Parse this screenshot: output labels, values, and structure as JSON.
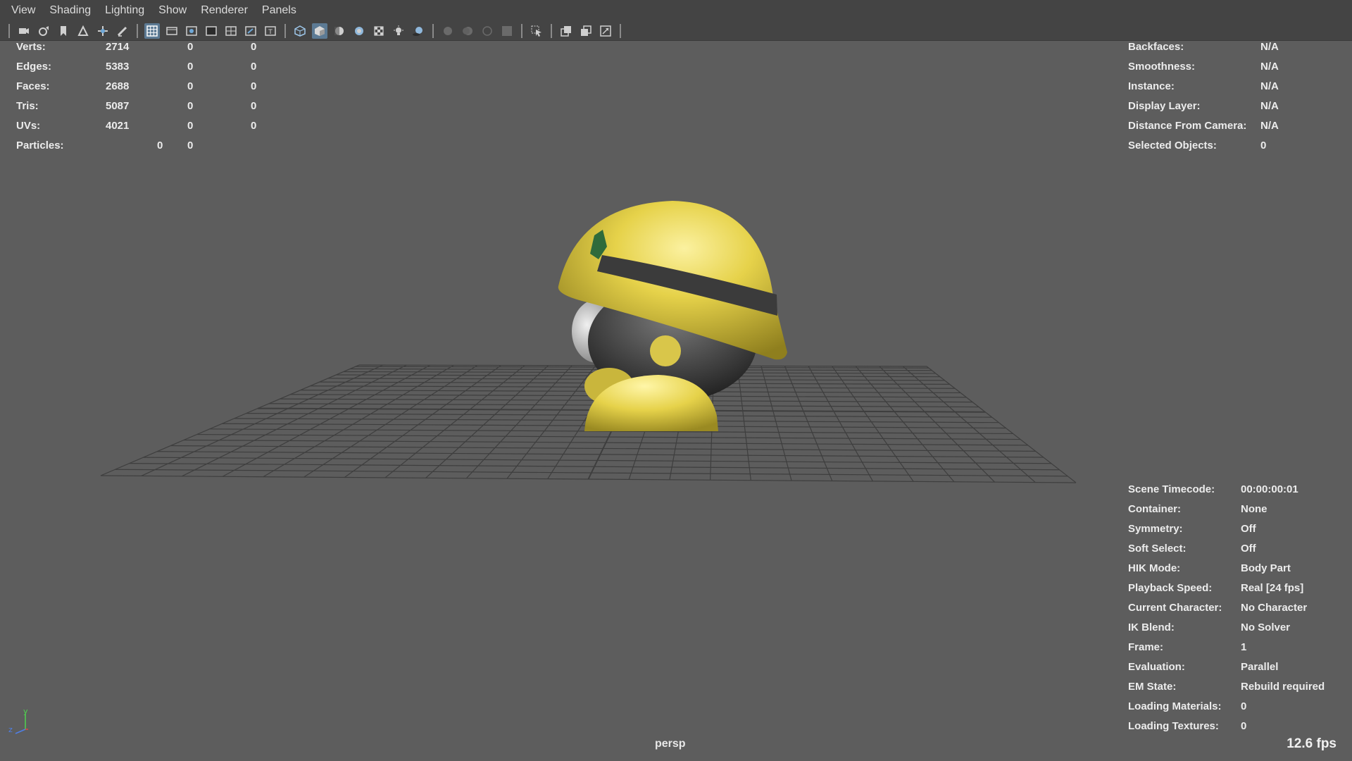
{
  "menu": [
    "View",
    "Shading",
    "Lighting",
    "Show",
    "Renderer",
    "Panels"
  ],
  "toolbar_icons": [
    "camera-icon",
    "camera-attr-icon",
    "bookmark-icon",
    "image-plane-icon",
    "2d-pan-icon",
    "grease-pencil-icon",
    "grid-icon",
    "film-gate-icon",
    "resolution-gate-icon",
    "gate-mask-icon",
    "field-chart-icon",
    "safe-action-icon",
    "safe-title-icon",
    "wireframe-icon",
    "smooth-shade-icon",
    "default-material-icon",
    "textured-icon",
    "xray-icon",
    "lights-icon",
    "shadows-icon",
    "screen-space-ao-icon",
    "motion-blur-icon",
    "anti-alias-icon",
    "depth-of-field-icon",
    "isolate-select-icon",
    "xray-joints-icon",
    "xray-active-icon",
    "backface-icon"
  ],
  "poly_stats": [
    {
      "label": "Verts:",
      "v1": "2714",
      "v2": "0",
      "v3": "0"
    },
    {
      "label": "Edges:",
      "v1": "5383",
      "v2": "0",
      "v3": "0"
    },
    {
      "label": "Faces:",
      "v1": "2688",
      "v2": "0",
      "v3": "0"
    },
    {
      "label": "Tris:",
      "v1": "5087",
      "v2": "0",
      "v3": "0"
    },
    {
      "label": "UVs:",
      "v1": "4021",
      "v2": "0",
      "v3": "0"
    }
  ],
  "particles": {
    "label": "Particles:",
    "v1": "0",
    "v2": "0"
  },
  "object_info": [
    {
      "label": "Backfaces:",
      "value": "N/A"
    },
    {
      "label": "Smoothness:",
      "value": "N/A"
    },
    {
      "label": "Instance:",
      "value": "N/A"
    },
    {
      "label": "Display Layer:",
      "value": "N/A"
    },
    {
      "label": "Distance From Camera:",
      "value": "N/A"
    },
    {
      "label": "Selected Objects:",
      "value": "0"
    }
  ],
  "scene_info": [
    {
      "label": "Scene Timecode:",
      "value": "00:00:00:01"
    },
    {
      "label": "Container:",
      "value": "None"
    },
    {
      "label": "Symmetry:",
      "value": "Off"
    },
    {
      "label": "Soft Select:",
      "value": "Off"
    },
    {
      "label": "HIK Mode:",
      "value": "Body Part"
    },
    {
      "label": "Playback Speed:",
      "value": "Real [24 fps]"
    },
    {
      "label": "Current Character:",
      "value": "No Character"
    },
    {
      "label": "IK Blend:",
      "value": "No Solver"
    },
    {
      "label": "Frame:",
      "value": "1"
    },
    {
      "label": "Evaluation:",
      "value": "Parallel"
    },
    {
      "label": "EM State:",
      "value": "Rebuild required"
    },
    {
      "label": "Loading Materials:",
      "value": "0"
    },
    {
      "label": "Loading Textures:",
      "value": "0"
    }
  ],
  "camera_name": "persp",
  "fps": "12.6 fps",
  "axis_labels": {
    "y": "y",
    "z": "z"
  },
  "colors": {
    "viewport_bg": "#5d5d5d",
    "toolbar_bg": "#444444",
    "helmet_yellow": "#e6d24a",
    "active_button": "#5c7a94"
  }
}
